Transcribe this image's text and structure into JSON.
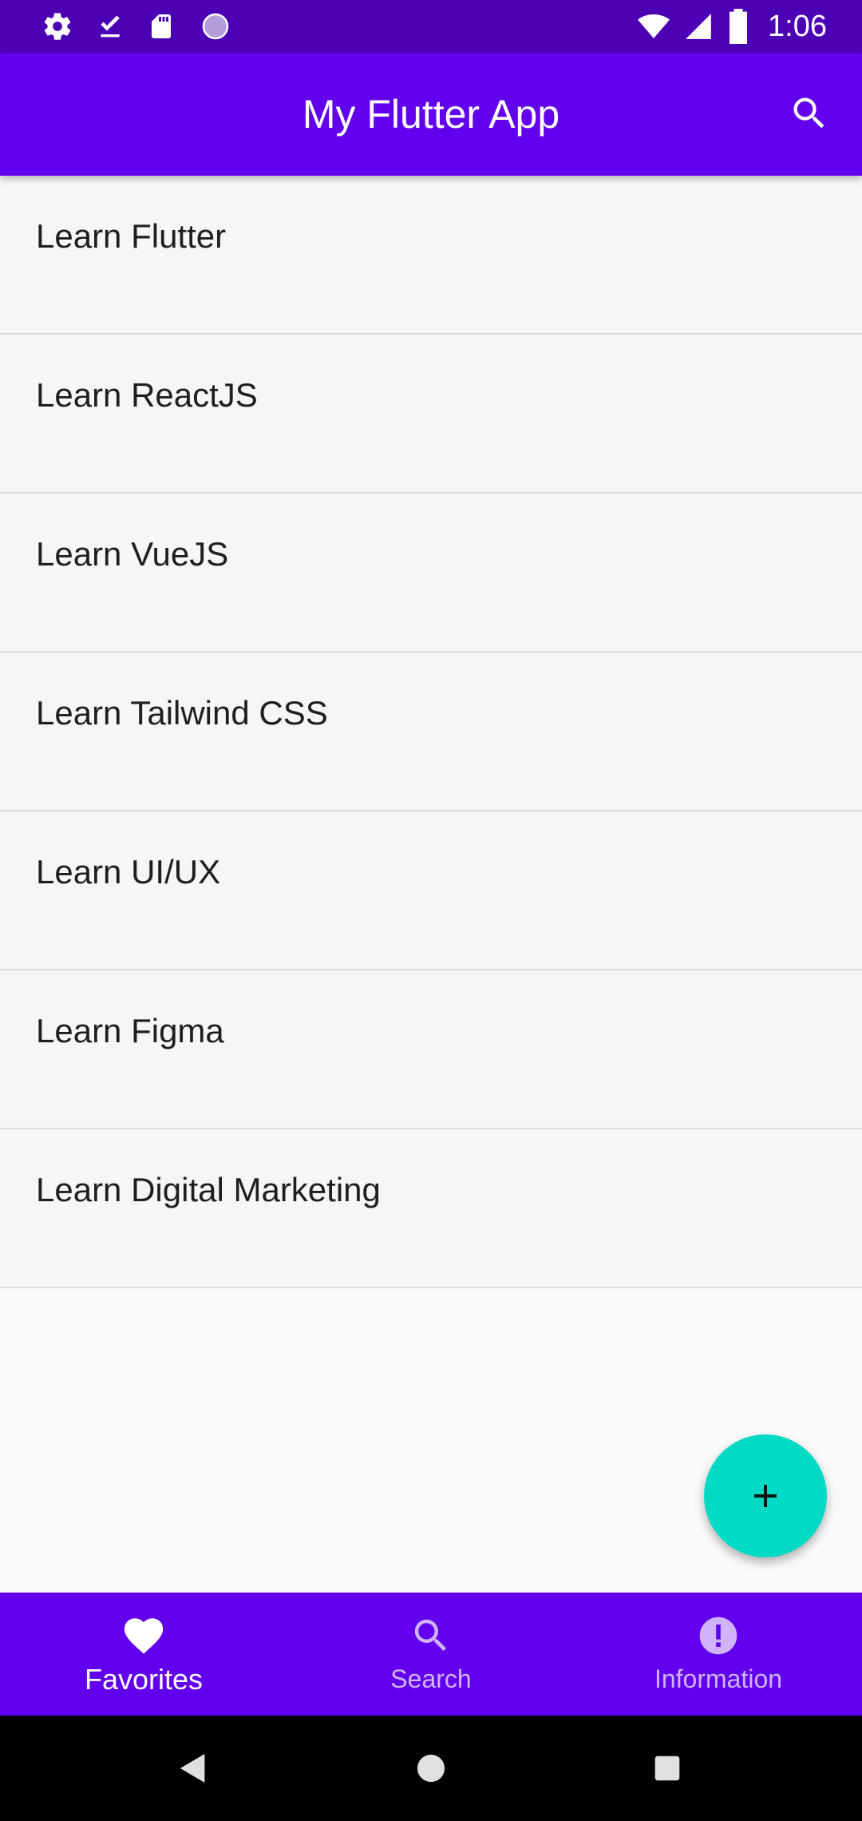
{
  "status_bar": {
    "time": "1:06",
    "icons_left": [
      "settings-icon",
      "download-done-icon",
      "sd-card-icon",
      "circle-icon"
    ],
    "icons_right": [
      "wifi-icon",
      "signal-icon",
      "battery-icon"
    ]
  },
  "app_bar": {
    "title": "My Flutter App",
    "action_icon": "search-icon"
  },
  "list": {
    "items": [
      {
        "label": "Learn Flutter"
      },
      {
        "label": "Learn ReactJS"
      },
      {
        "label": "Learn VueJS"
      },
      {
        "label": "Learn Tailwind CSS"
      },
      {
        "label": "Learn UI/UX"
      },
      {
        "label": "Learn Figma"
      },
      {
        "label": "Learn Digital Marketing"
      }
    ]
  },
  "fab": {
    "icon": "add-icon"
  },
  "bottom_nav": {
    "items": [
      {
        "label": "Favorites",
        "icon": "heart-icon",
        "active": true
      },
      {
        "label": "Search",
        "icon": "search-icon",
        "active": false
      },
      {
        "label": "Information",
        "icon": "info-icon",
        "active": false
      }
    ]
  },
  "system_nav": {
    "buttons": [
      "back-icon",
      "home-icon",
      "recents-icon"
    ]
  },
  "colors": {
    "primary": "#6200ee",
    "status_bar": "#4c00b4",
    "accent": "#03dac5",
    "background": "#fafafa"
  }
}
